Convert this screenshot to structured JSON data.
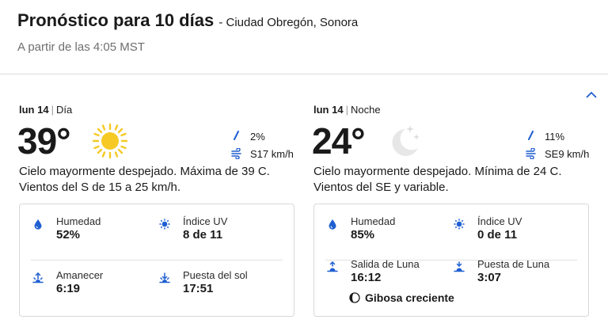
{
  "header": {
    "title": "Pronóstico para 10 días",
    "location": "- Ciudad Obregón, Sonora",
    "updated": "A partir de las 4:05 MST"
  },
  "day": {
    "date": "lun 14",
    "period": "Día",
    "temp": "39°",
    "icon": "sun-icon",
    "precip": "2%",
    "wind": "S17 km/h",
    "description": "Cielo mayormente despejado. Máxima de 39 C. Vientos del S de 15 a 25 km/h.",
    "details": {
      "humidity_label": "Humedad",
      "humidity": "52%",
      "uv_label": "Índice UV",
      "uv": "8 de 11",
      "sunrise_label": "Amanecer",
      "sunrise": "6:19",
      "sunset_label": "Puesta del sol",
      "sunset": "17:51"
    }
  },
  "night": {
    "date": "lun 14",
    "period": "Noche",
    "temp": "24°",
    "icon": "moon-stars-icon",
    "precip": "11%",
    "wind": "SE9 km/h",
    "description": "Cielo mayormente despejado. Mínima de 24 C. Vientos del SE y variable.",
    "details": {
      "humidity_label": "Humedad",
      "humidity": "85%",
      "uv_label": "Índice UV",
      "uv": "0 de 11",
      "moonrise_label": "Salida de Luna",
      "moonrise": "16:12",
      "moonset_label": "Puesta de Luna",
      "moonset": "3:07",
      "moon_phase": "Gibosa creciente"
    }
  },
  "colors": {
    "accent": "#1f5fd1",
    "sun": "#f6c924",
    "text": "#1a1a1a",
    "muted": "#6f6f6f"
  }
}
